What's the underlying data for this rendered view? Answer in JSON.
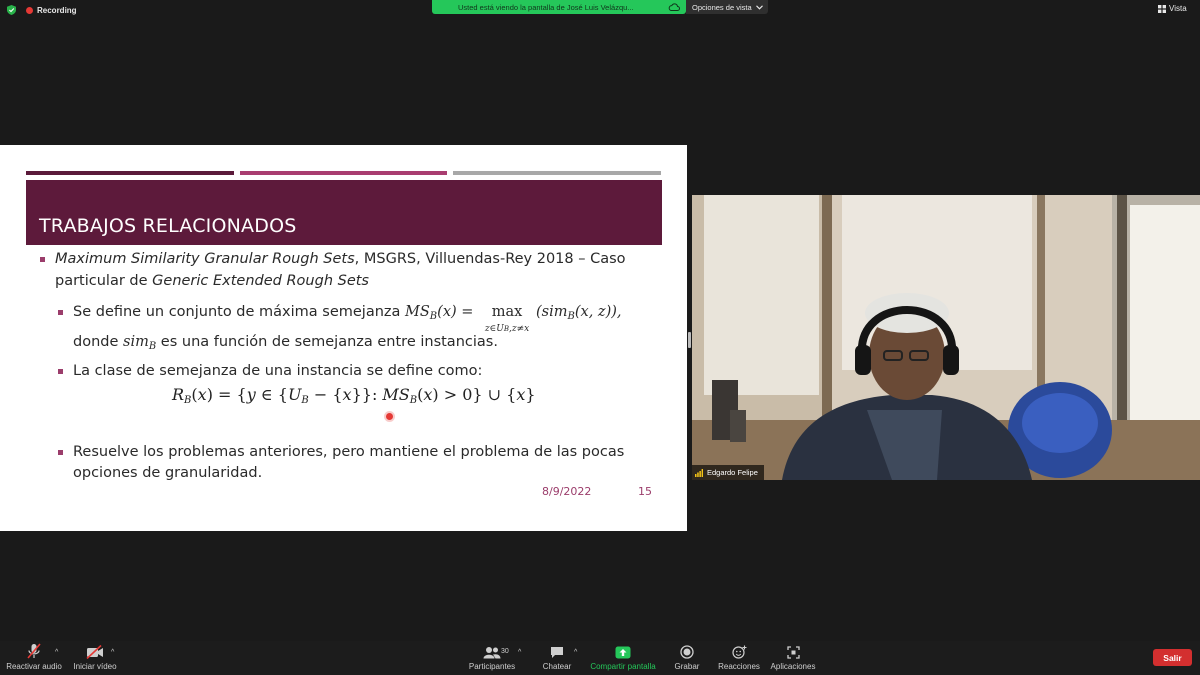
{
  "top_bar": {
    "recording_label": "Recording",
    "share_banner": "Usted está viendo la pantalla de José Luis Velázqu...",
    "view_options": "Opciones de vista",
    "view_button": "Vista"
  },
  "slide": {
    "title": "TRABAJOS RELACIONADOS",
    "bullet1": {
      "italic1": "Maximum Similarity Granular Rough Sets",
      "plain1": ",  MSGRS, Villuendas-Rey 2018 – Caso",
      "plain2": "particular de ",
      "italic2": "Generic Extended Rough Sets"
    },
    "sub1": {
      "text_a": "Se define un conjunto de máxima semejanza ",
      "text_b": "donde ",
      "text_c": " es una función de semejanza entre instancias."
    },
    "sub2": {
      "text": "La clase de semejanza de una instancia se define como:"
    },
    "sub3": {
      "line1": "Resuelve los problemas anteriores, pero mantiene el problema de las pocas",
      "line2": "opciones de granularidad."
    },
    "date": "8/9/2022",
    "page": "15"
  },
  "video": {
    "participant_name": "Edgardo Felipe"
  },
  "toolbar": {
    "audio": "Reactivar audio",
    "video": "Iniciar vídeo",
    "participants": "Participantes",
    "participants_count": "30",
    "chat": "Chatear",
    "share": "Compartir pantalla",
    "record": "Grabar",
    "reactions": "Reacciones",
    "apps": "Aplicaciones",
    "leave": "Salir"
  },
  "colors": {
    "accent_green": "#25c75a",
    "slide_title_band": "#5d1a3b",
    "bullet": "#9b3d6b",
    "leave_red": "#d32f2f",
    "recording_red": "#e53935"
  },
  "icons": [
    "shield-icon",
    "recording-dot-icon",
    "cloud-icon",
    "chevron-down-icon",
    "grid-view-icon",
    "microphone-muted-icon",
    "video-off-icon",
    "participants-icon",
    "chat-icon",
    "share-screen-icon",
    "record-icon",
    "reactions-icon",
    "apps-icon",
    "signal-icon"
  ]
}
